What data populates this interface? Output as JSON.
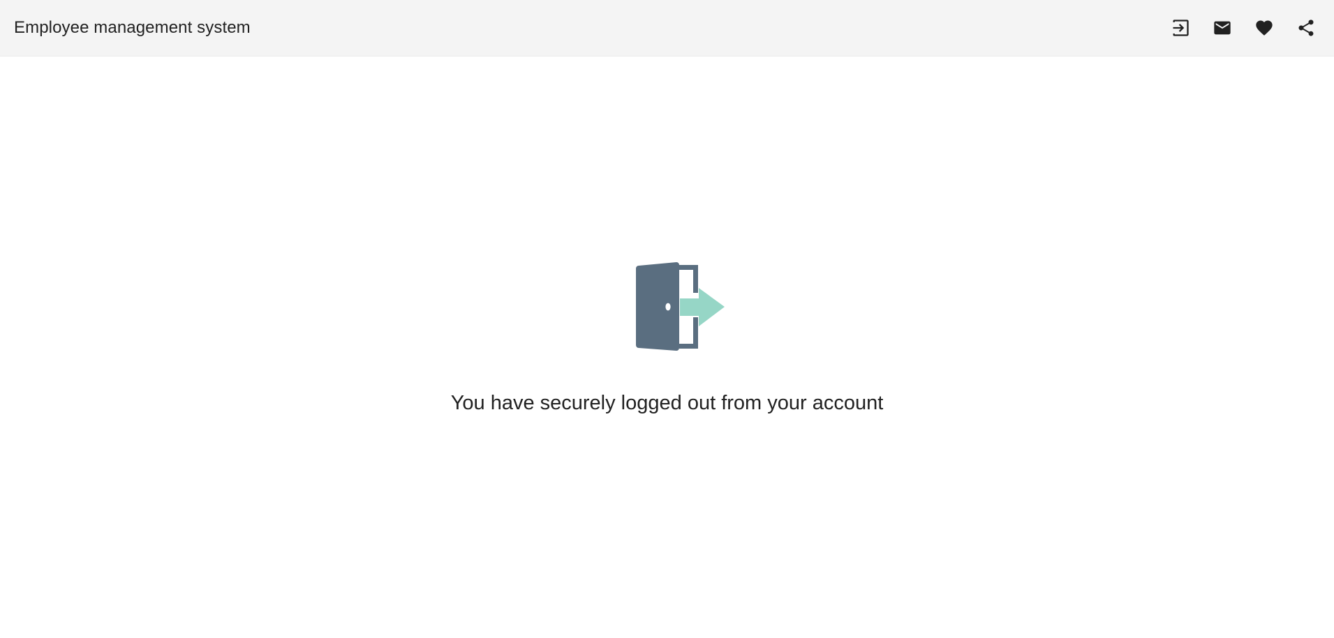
{
  "app_bar": {
    "title": "Employee management system",
    "actions": [
      {
        "name": "login-icon",
        "label": ""
      },
      {
        "name": "mail-icon",
        "label": ""
      },
      {
        "name": "heart-icon",
        "label": ""
      },
      {
        "name": "share-icon",
        "label": ""
      }
    ]
  },
  "main": {
    "illustration": {
      "icon": "door-exit-icon",
      "door_color": "#5a6e80",
      "arrow_color": "#96d6c6"
    },
    "message": "You have securely logged out from your account"
  },
  "colors": {
    "app_bar_background": "#f4f4f4",
    "page_background": "#ffffff",
    "text": "#212121"
  }
}
